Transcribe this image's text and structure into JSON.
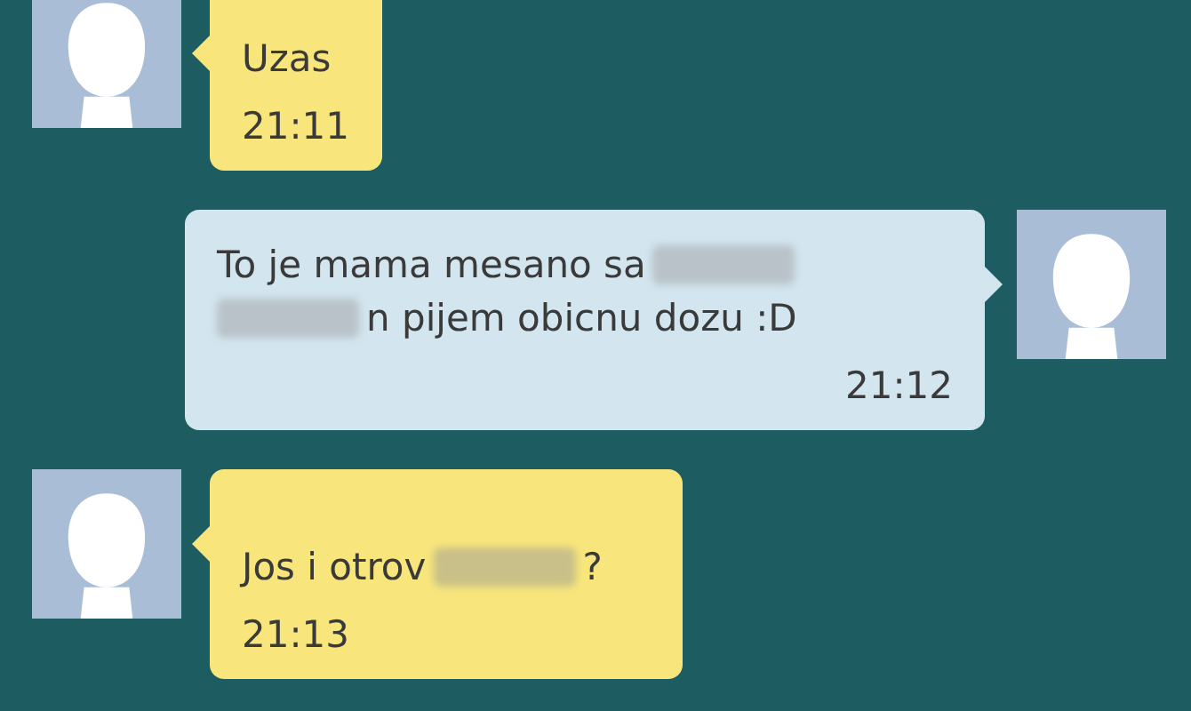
{
  "messages": [
    {
      "outgoing": false,
      "lines": [
        [
          {
            "kind": "text",
            "text": "Uzas"
          }
        ]
      ],
      "time": "21:11"
    },
    {
      "outgoing": true,
      "lines": [
        [
          {
            "kind": "text",
            "text": "To je mama mesano sa"
          },
          {
            "kind": "blur"
          }
        ],
        [
          {
            "kind": "blur"
          },
          {
            "kind": "text",
            "text": "n pijem obicnu dozu :D"
          }
        ]
      ],
      "time": "21:12"
    },
    {
      "outgoing": false,
      "lines": [
        [
          {
            "kind": "text",
            "text": "Jos i otrov"
          },
          {
            "kind": "blur"
          },
          {
            "kind": "text",
            "text": "?"
          }
        ]
      ],
      "time": "21:13"
    }
  ]
}
